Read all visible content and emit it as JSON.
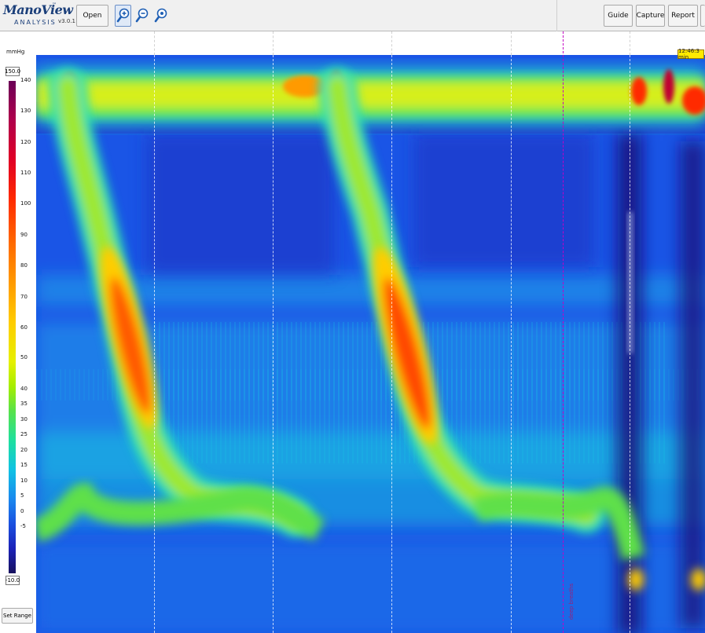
{
  "app": {
    "logo_text": "ManoView",
    "logo_sub": "ANALYSIS",
    "logo_tm": "™",
    "version": "v3.0.1"
  },
  "toolbar": {
    "open_label": "Open",
    "guide_label": "Guide",
    "capture_label": "Capture",
    "report_label": "Report",
    "zoom_in_icon": "zoom-in-icon",
    "zoom_out_icon": "zoom-out-icon",
    "zoom_reset_icon": "zoom-reset-icon"
  },
  "scale": {
    "unit": "mmHg",
    "max_value": "150.0",
    "min_value": "-10.0",
    "ticks": [
      "140",
      "130",
      "120",
      "110",
      "100",
      "90",
      "80",
      "70",
      "60",
      "50",
      "40",
      "35",
      "30",
      "25",
      "20",
      "15",
      "10",
      "5",
      "0",
      "-5"
    ],
    "set_range_label": "Set Range",
    "colors": [
      "#6b0057",
      "#e00026",
      "#ff6a00",
      "#ffcc00",
      "#a6ee00",
      "#1ee09e",
      "#1a88ee",
      "#1b22b8",
      "#17115e"
    ]
  },
  "timeline": {
    "time_label": "12:46:3 min",
    "annotation": "deep breaths"
  }
}
